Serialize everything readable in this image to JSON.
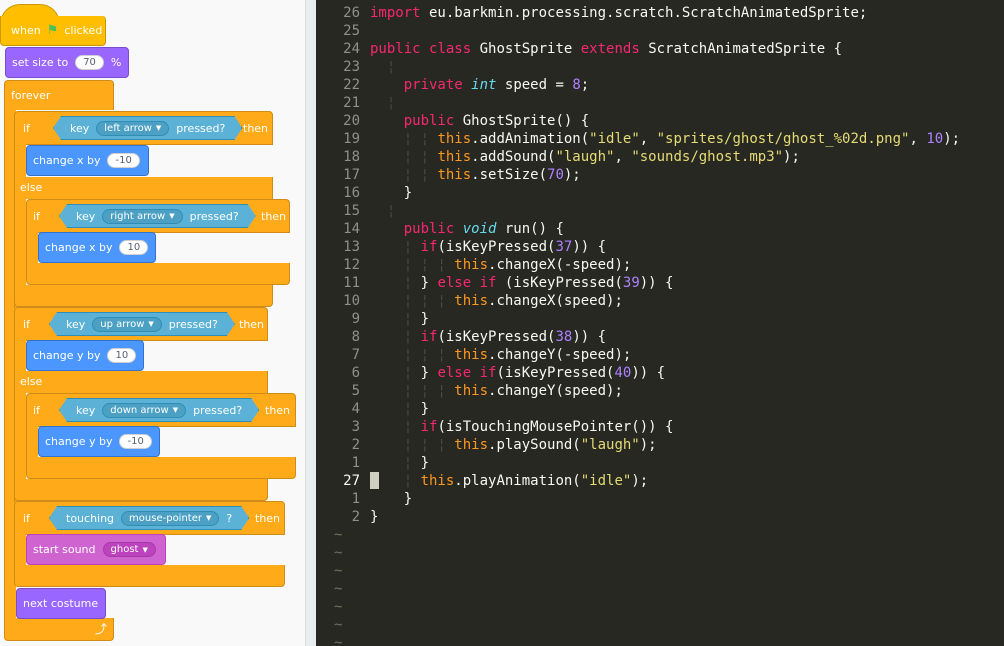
{
  "scratch": {
    "hat": {
      "when": "when",
      "clicked": "clicked"
    },
    "set_size": {
      "label": "set size to",
      "value": "70",
      "unit": "%"
    },
    "forever": "forever",
    "if1": {
      "if": "if",
      "key": "key",
      "option": "left arrow",
      "pressed": "pressed?",
      "then": "then"
    },
    "change1": {
      "label": "change x by",
      "value": "-10"
    },
    "else1": "else",
    "if2": {
      "if": "if",
      "key": "key",
      "option": "right arrow",
      "pressed": "pressed?",
      "then": "then"
    },
    "change2": {
      "label": "change x by",
      "value": "10"
    },
    "if3": {
      "if": "if",
      "key": "key",
      "option": "up arrow",
      "pressed": "pressed?",
      "then": "then"
    },
    "change3": {
      "label": "change y by",
      "value": "10"
    },
    "else2": "else",
    "if4": {
      "if": "if",
      "key": "key",
      "option": "down arrow",
      "pressed": "pressed?",
      "then": "then"
    },
    "change4": {
      "label": "change y by",
      "value": "-10"
    },
    "if5": {
      "if": "if",
      "touching": "touching",
      "option": "mouse-pointer",
      "q": "?",
      "then": "then"
    },
    "sound": {
      "label": "start sound",
      "option": "ghost"
    },
    "next_costume": "next costume",
    "loop_icon": "loop-arrow-icon"
  },
  "editor": {
    "lines": [
      {
        "n": "26",
        "tokens": [
          [
            "kw",
            "import"
          ],
          [
            "plain",
            " eu.barkmin.processing.scratch.ScratchAnimatedSprite;"
          ]
        ]
      },
      {
        "n": "25",
        "tokens": []
      },
      {
        "n": "24",
        "tokens": [
          [
            "kw",
            "public"
          ],
          [
            "plain",
            " "
          ],
          [
            "kw",
            "class"
          ],
          [
            "plain",
            " GhostSprite "
          ],
          [
            "kw",
            "extends"
          ],
          [
            "plain",
            " ScratchAnimatedSprite {"
          ]
        ]
      },
      {
        "n": "23",
        "tokens": [
          [
            "guide",
            "  ¦ "
          ]
        ]
      },
      {
        "n": "22",
        "tokens": [
          [
            "plain",
            "    "
          ],
          [
            "kw",
            "private"
          ],
          [
            "plain",
            " "
          ],
          [
            "type",
            "int"
          ],
          [
            "plain",
            " speed = "
          ],
          [
            "num",
            "8"
          ],
          [
            "plain",
            ";"
          ]
        ]
      },
      {
        "n": "21",
        "tokens": [
          [
            "guide",
            "  ¦ "
          ]
        ]
      },
      {
        "n": "20",
        "tokens": [
          [
            "plain",
            "    "
          ],
          [
            "kw",
            "public"
          ],
          [
            "plain",
            " GhostSprite() {"
          ]
        ]
      },
      {
        "n": "19",
        "tokens": [
          [
            "guide",
            "    ¦ ¦ "
          ],
          [
            "this",
            "this"
          ],
          [
            "plain",
            ".addAnimation("
          ],
          [
            "str",
            "\"idle\""
          ],
          [
            "plain",
            ", "
          ],
          [
            "str",
            "\"sprites/ghost/ghost_%02d.png\""
          ],
          [
            "plain",
            ", "
          ],
          [
            "num",
            "10"
          ],
          [
            "plain",
            ");"
          ]
        ]
      },
      {
        "n": "18",
        "tokens": [
          [
            "guide",
            "    ¦ ¦ "
          ],
          [
            "this",
            "this"
          ],
          [
            "plain",
            ".addSound("
          ],
          [
            "str",
            "\"laugh\""
          ],
          [
            "plain",
            ", "
          ],
          [
            "str",
            "\"sounds/ghost.mp3\""
          ],
          [
            "plain",
            ");"
          ]
        ]
      },
      {
        "n": "17",
        "tokens": [
          [
            "guide",
            "    ¦ ¦ "
          ],
          [
            "this",
            "this"
          ],
          [
            "plain",
            ".setSize("
          ],
          [
            "num",
            "70"
          ],
          [
            "plain",
            ");"
          ]
        ]
      },
      {
        "n": "16",
        "tokens": [
          [
            "plain",
            "    }"
          ]
        ]
      },
      {
        "n": "15",
        "tokens": [
          [
            "guide",
            "  ¦ "
          ]
        ]
      },
      {
        "n": "14",
        "tokens": [
          [
            "plain",
            "    "
          ],
          [
            "kw",
            "public"
          ],
          [
            "plain",
            " "
          ],
          [
            "type",
            "void"
          ],
          [
            "plain",
            " run() {"
          ]
        ]
      },
      {
        "n": "13",
        "tokens": [
          [
            "guide",
            "    ¦ "
          ],
          [
            "kw",
            "if"
          ],
          [
            "plain",
            "(isKeyPressed("
          ],
          [
            "num",
            "37"
          ],
          [
            "plain",
            ")) {"
          ]
        ]
      },
      {
        "n": "12",
        "tokens": [
          [
            "guide",
            "    ¦ ¦ ¦ "
          ],
          [
            "this",
            "this"
          ],
          [
            "plain",
            ".changeX(-speed);"
          ]
        ]
      },
      {
        "n": "11",
        "tokens": [
          [
            "guide",
            "    ¦ "
          ],
          [
            "plain",
            "} "
          ],
          [
            "kw",
            "else if"
          ],
          [
            "plain",
            " (isKeyPressed("
          ],
          [
            "num",
            "39"
          ],
          [
            "plain",
            ")) {"
          ]
        ]
      },
      {
        "n": "10",
        "tokens": [
          [
            "guide",
            "    ¦ ¦ ¦ "
          ],
          [
            "this",
            "this"
          ],
          [
            "plain",
            ".changeX(speed);"
          ]
        ]
      },
      {
        "n": "9",
        "tokens": [
          [
            "guide",
            "    ¦ "
          ],
          [
            "plain",
            "}"
          ]
        ]
      },
      {
        "n": "8",
        "tokens": [
          [
            "guide",
            "    ¦ "
          ],
          [
            "kw",
            "if"
          ],
          [
            "plain",
            "(isKeyPressed("
          ],
          [
            "num",
            "38"
          ],
          [
            "plain",
            ")) {"
          ]
        ]
      },
      {
        "n": "7",
        "tokens": [
          [
            "guide",
            "    ¦ ¦ ¦ "
          ],
          [
            "this",
            "this"
          ],
          [
            "plain",
            ".changeY(-speed);"
          ]
        ]
      },
      {
        "n": "6",
        "tokens": [
          [
            "guide",
            "    ¦ "
          ],
          [
            "plain",
            "} "
          ],
          [
            "kw",
            "else if"
          ],
          [
            "plain",
            "(isKeyPressed("
          ],
          [
            "num",
            "40"
          ],
          [
            "plain",
            ")) {"
          ]
        ]
      },
      {
        "n": "5",
        "tokens": [
          [
            "guide",
            "    ¦ ¦ ¦ "
          ],
          [
            "this",
            "this"
          ],
          [
            "plain",
            ".changeY(speed);"
          ]
        ]
      },
      {
        "n": "4",
        "tokens": [
          [
            "guide",
            "    ¦ "
          ],
          [
            "plain",
            "}"
          ]
        ]
      },
      {
        "n": "3",
        "tokens": [
          [
            "guide",
            "    ¦ "
          ],
          [
            "kw",
            "if"
          ],
          [
            "plain",
            "(isTouchingMousePointer()) {"
          ]
        ]
      },
      {
        "n": "2",
        "tokens": [
          [
            "guide",
            "    ¦ ¦ ¦ "
          ],
          [
            "this",
            "this"
          ],
          [
            "plain",
            ".playSound("
          ],
          [
            "str",
            "\"laugh\""
          ],
          [
            "plain",
            ");"
          ]
        ]
      },
      {
        "n": "1",
        "tokens": [
          [
            "guide",
            "    ¦ "
          ],
          [
            "plain",
            "}"
          ]
        ]
      },
      {
        "n": "27",
        "current": true,
        "tokens": [
          [
            "guide",
            "    ¦ "
          ],
          [
            "this",
            "this"
          ],
          [
            "plain",
            ".playAnimation("
          ],
          [
            "str",
            "\"idle\""
          ],
          [
            "plain",
            ");"
          ]
        ]
      },
      {
        "n": "1",
        "tokens": [
          [
            "plain",
            "    }"
          ]
        ]
      },
      {
        "n": "2",
        "tokens": [
          [
            "plain",
            "}"
          ]
        ]
      }
    ],
    "tilde": "~",
    "tilde_count": 7,
    "colors": {
      "background": "#272822",
      "keyword": "#f92672",
      "string": "#e6db74",
      "number": "#ae81ff"
    }
  }
}
